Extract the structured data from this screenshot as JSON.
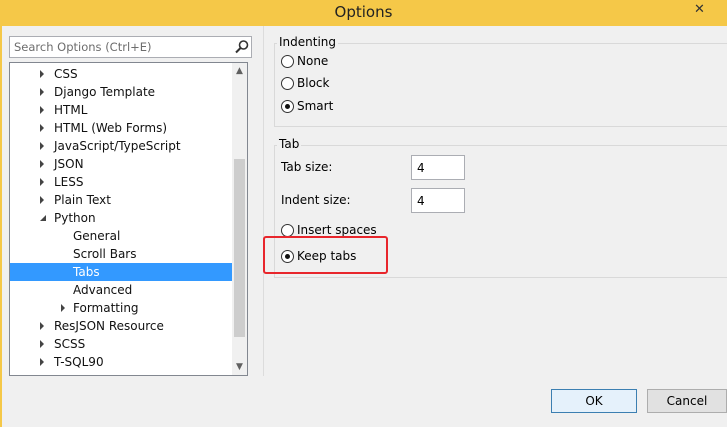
{
  "window": {
    "title": "Options",
    "close_glyph": "✕"
  },
  "search": {
    "placeholder": "Search Options (Ctrl+E)"
  },
  "tree": {
    "items": [
      {
        "label": "CSS",
        "expanded": false,
        "selected": false
      },
      {
        "label": "Django Template",
        "expanded": false,
        "selected": false
      },
      {
        "label": "HTML",
        "expanded": false,
        "selected": false
      },
      {
        "label": "HTML (Web Forms)",
        "expanded": false,
        "selected": false
      },
      {
        "label": "JavaScript/TypeScript",
        "expanded": false,
        "selected": false
      },
      {
        "label": "JSON",
        "expanded": false,
        "selected": false
      },
      {
        "label": "LESS",
        "expanded": false,
        "selected": false
      },
      {
        "label": "Plain Text",
        "expanded": false,
        "selected": false
      },
      {
        "label": "Python",
        "expanded": true,
        "selected": false
      },
      {
        "label": "General",
        "expanded": null,
        "selected": false
      },
      {
        "label": "Scroll Bars",
        "expanded": null,
        "selected": false
      },
      {
        "label": "Tabs",
        "expanded": null,
        "selected": true
      },
      {
        "label": "Advanced",
        "expanded": null,
        "selected": false
      },
      {
        "label": "Formatting",
        "expanded": false,
        "selected": false
      },
      {
        "label": "ResJSON Resource",
        "expanded": false,
        "selected": false
      },
      {
        "label": "SCSS",
        "expanded": false,
        "selected": false
      },
      {
        "label": "T-SQL90",
        "expanded": false,
        "selected": false
      }
    ]
  },
  "indenting": {
    "title": "Indenting",
    "options": [
      {
        "label": "None",
        "checked": false
      },
      {
        "label": "Block",
        "checked": false
      },
      {
        "label": "Smart",
        "checked": true
      }
    ]
  },
  "tab": {
    "title": "Tab",
    "tab_size_label": "Tab size:",
    "tab_size_value": "4",
    "indent_size_label": "Indent size:",
    "indent_size_value": "4",
    "options": [
      {
        "label": "Insert spaces",
        "checked": false
      },
      {
        "label": "Keep tabs",
        "checked": true
      }
    ]
  },
  "buttons": {
    "ok": "OK",
    "cancel": "Cancel"
  },
  "colors": {
    "title_bar": "#f5c848",
    "selection": "#3399ff",
    "highlight_box": "#e8262c"
  }
}
